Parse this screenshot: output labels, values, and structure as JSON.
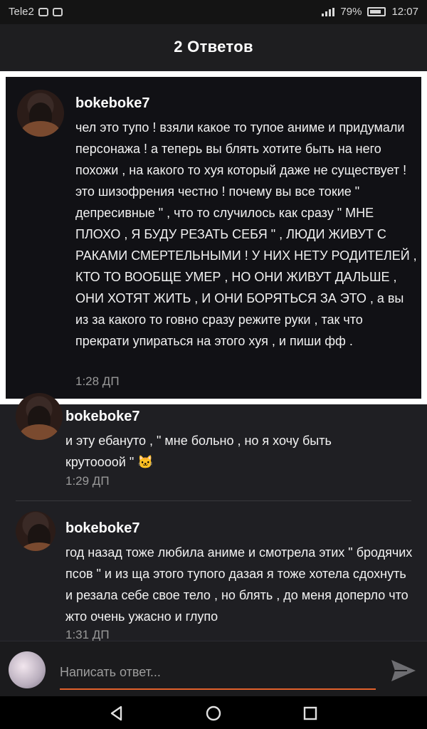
{
  "status": {
    "carrier": "Tele2",
    "battery": "79%",
    "time": "12:07"
  },
  "header": {
    "title": "2 Ответов"
  },
  "messages": [
    {
      "author": "bokeboke7",
      "text": "чел это тупо ! взяли какое то тупое аниме и придумали персонажа ! а теперь вы блять хотите быть на него похожи , на какого то хуя который даже не существует ! это шизофрения честно ! почему вы все токие \" депресивные \" , что то случилось как сразу \" МНЕ ПЛОХО , Я БУДУ РЕЗАТЬ СЕБЯ \" , ЛЮДИ ЖИВУТ С РАКАМИ СМЕРТЕЛЬНЫМИ ! У НИХ НЕТУ РОДИТЕЛЕЙ , КТО ТО ВООБЩЕ УМЕР , НО ОНИ ЖИВУТ ДАЛЬШЕ , ОНИ ХОТЯТ ЖИТЬ , И ОНИ БОРЯТЬСЯ ЗА ЭТО , а вы из за какого то говно сразу режите руки , так что прекрати упираться на этого хуя , и пиши фф .",
      "time": "1:28 ДП"
    },
    {
      "author": "bokeboke7",
      "text": "и эту ебануто , \" мне больно , но я хочу быть крутоооой \" 🐱",
      "time": "1:29 ДП"
    },
    {
      "author": "bokeboke7",
      "text": "год назад тоже любила аниме и смотрела этих \" бродячих псов \" и из ща этого тупого дазая я тоже хотела сдохнуть и резала себе свое тело , но блять , до меня доперло что жто очень ужасно и глупо",
      "time": "1:31 ДП"
    }
  ],
  "reply": {
    "placeholder": "Написать ответ..."
  },
  "icons": {
    "send": "send-icon",
    "back": "back-icon",
    "home": "home-icon",
    "recents": "recents-icon"
  },
  "colors": {
    "accent": "#e2612b",
    "background": "#1f1f23"
  }
}
